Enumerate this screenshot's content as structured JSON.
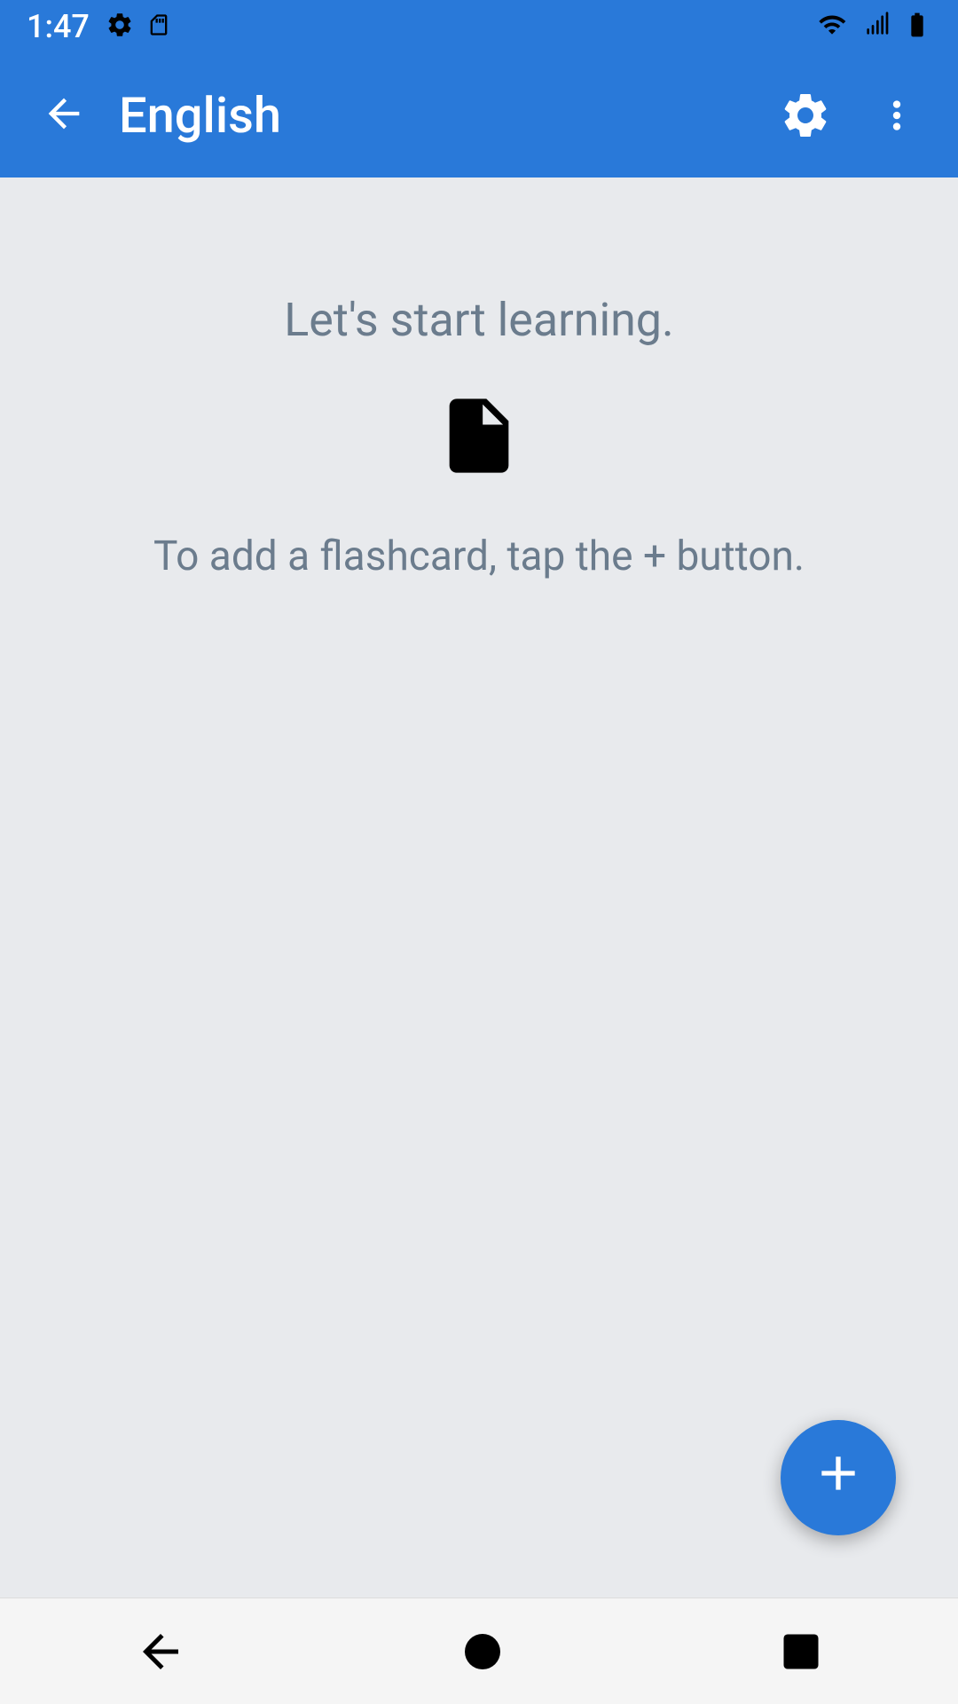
{
  "status_bar": {
    "time": "1:47",
    "icons": [
      "settings",
      "sd-card",
      "wifi",
      "signal",
      "battery"
    ]
  },
  "app_bar": {
    "title": "English",
    "back_label": "back",
    "settings_label": "settings",
    "more_label": "more options"
  },
  "main": {
    "empty_title": "Let's start learning.",
    "empty_subtitle": "To add a flashcard, tap the + button.",
    "flashcard_icon_label": "flashcard"
  },
  "fab": {
    "label": "+"
  },
  "nav_bar": {
    "back_label": "back",
    "home_label": "home",
    "recents_label": "recents"
  }
}
